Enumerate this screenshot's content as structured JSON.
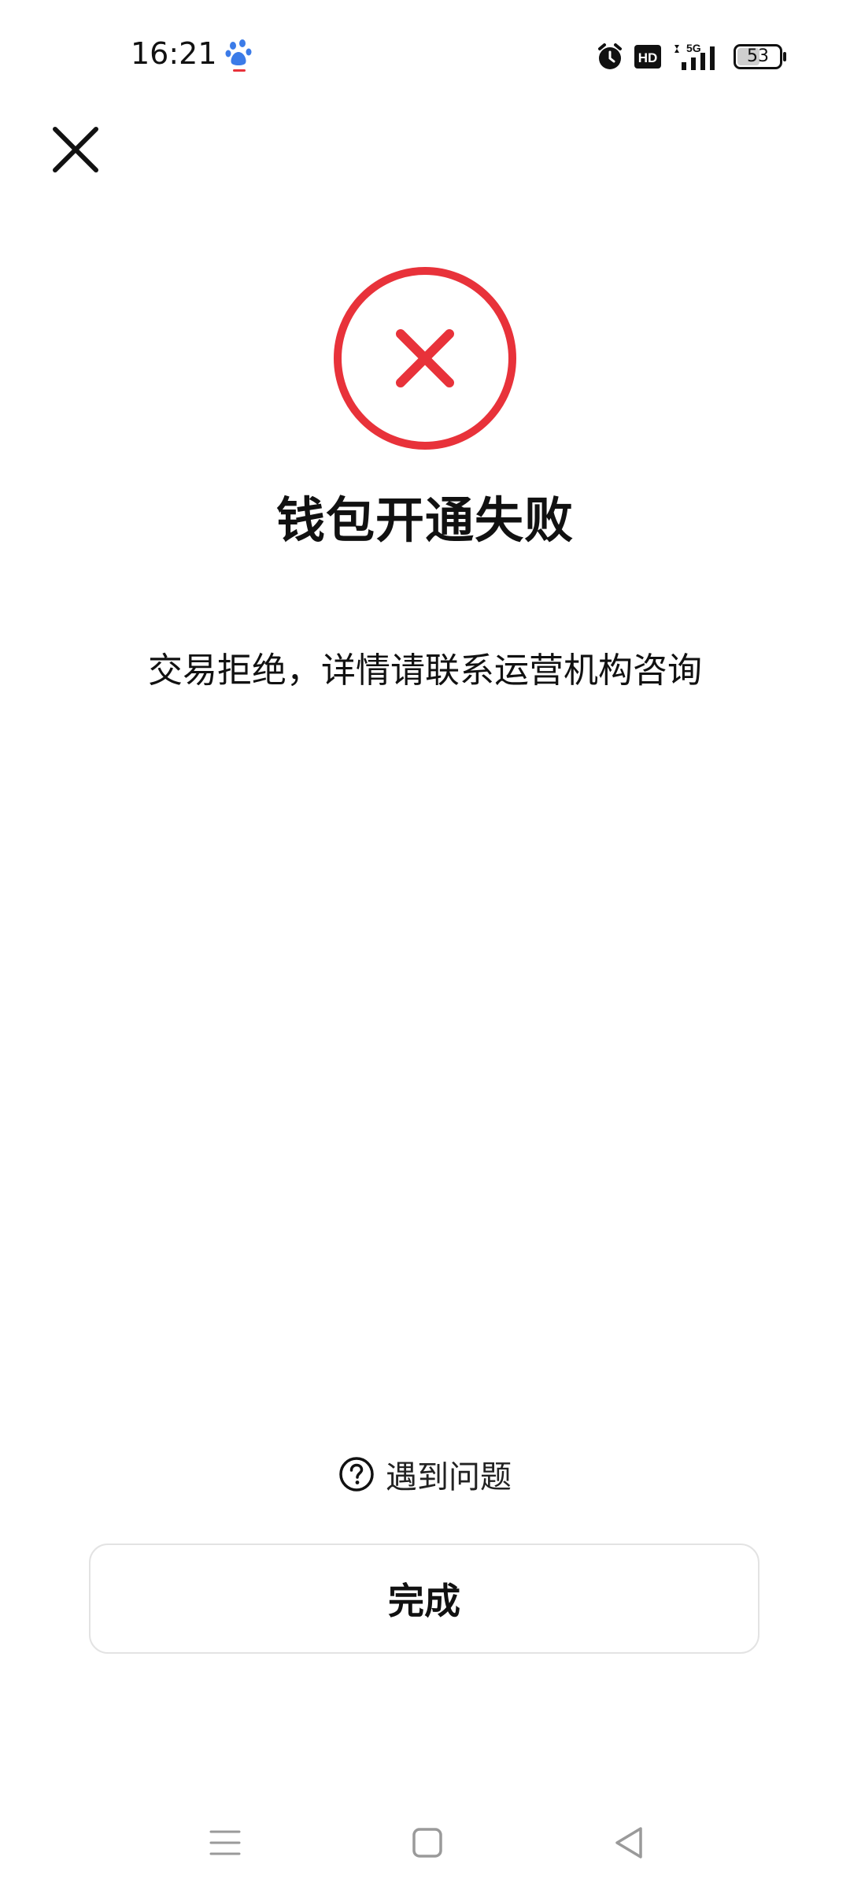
{
  "status_bar": {
    "time": "16:21",
    "network_label": "5G",
    "hd_label": "HD",
    "battery_level": "53"
  },
  "result": {
    "title": "钱包开通失败",
    "message": "交易拒绝，详情请联系运营机构咨询",
    "status_color": "#e8323a"
  },
  "help": {
    "label": "遇到问题"
  },
  "actions": {
    "done_label": "完成"
  }
}
